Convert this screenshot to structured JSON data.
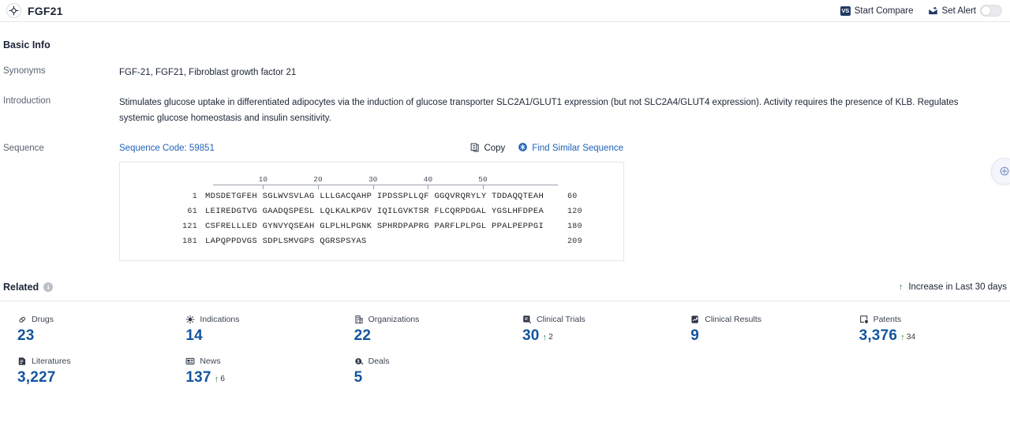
{
  "header": {
    "entity_name": "FGF21",
    "entity_icon": "target-icon",
    "start_compare": "Start Compare",
    "compare_icon_text": "VS",
    "set_alert": "Set Alert",
    "alert_toggle_state": "off"
  },
  "basic_info": {
    "title": "Basic Info",
    "synonyms_label": "Synonyms",
    "synonyms_value": "FGF-21,  FGF21,  Fibroblast growth factor 21",
    "introduction_label": "Introduction",
    "introduction_value": "Stimulates glucose uptake in differentiated adipocytes via the induction of glucose transporter SLC2A1/GLUT1 expression (but not SLC2A4/GLUT4 expression). Activity requires the presence of KLB. Regulates systemic glucose homeostasis and insulin sensitivity."
  },
  "sequence": {
    "label": "Sequence",
    "code_text": "Sequence Code: 59851",
    "copy_label": "Copy",
    "find_similar_label": "Find Similar Sequence",
    "ruler_ticks": [
      10,
      20,
      30,
      40,
      50
    ],
    "lines": [
      {
        "start": "1",
        "residues": "MDSDETGFEH SGLWVSVLAG LLLGACQAHP IPDSSPLLQF GGQVRQRYLY TDDAQQTEAH",
        "end": "60"
      },
      {
        "start": "61",
        "residues": "LEIREDGTVG GAADQSPESL LQLKALKPGV IQILGVKTSR FLCQRPDGAL YGSLHFDPEA",
        "end": "120"
      },
      {
        "start": "121",
        "residues": "CSFRELLLED GYNVYQSEAH GLPLHLPGNK SPHRDPAPRG PARFLPLPGL PPALPEPPGI",
        "end": "180"
      },
      {
        "start": "181",
        "residues": "LAPQPPDVGS SDPLSMVGPS QGRSPSYAS",
        "end": "209"
      }
    ]
  },
  "related": {
    "title": "Related",
    "info_icon": "info-icon",
    "legend_text": "Increase in Last 30 days",
    "cards": [
      {
        "icon": "capsule-icon",
        "label": "Drugs",
        "value": "23",
        "delta": ""
      },
      {
        "icon": "virus-icon",
        "label": "Indications",
        "value": "14",
        "delta": ""
      },
      {
        "icon": "building-icon",
        "label": "Organizations",
        "value": "22",
        "delta": ""
      },
      {
        "icon": "clinical-trial-icon",
        "label": "Clinical Trials",
        "value": "30",
        "delta": "2"
      },
      {
        "icon": "clinical-result-icon",
        "label": "Clinical Results",
        "value": "9",
        "delta": ""
      },
      {
        "icon": "patent-icon",
        "label": "Patents",
        "value": "3,376",
        "delta": "34"
      },
      {
        "icon": "literature-icon",
        "label": "Literatures",
        "value": "3,227",
        "delta": ""
      },
      {
        "icon": "news-icon",
        "label": "News",
        "value": "137",
        "delta": "6"
      },
      {
        "icon": "deals-icon",
        "label": "Deals",
        "value": "5",
        "delta": ""
      }
    ]
  },
  "colors": {
    "accent_blue": "#13559e",
    "link_blue": "#2163b8",
    "increase_green": "#1f8b3d",
    "header_navy": "#1f3a63"
  }
}
